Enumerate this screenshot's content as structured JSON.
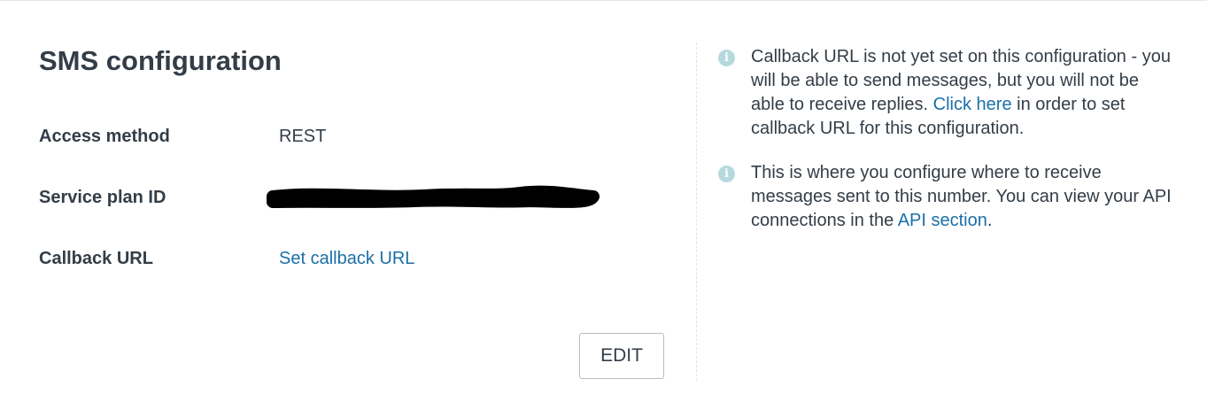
{
  "config": {
    "title": "SMS configuration",
    "rows": [
      {
        "label": "Access method",
        "value": "REST"
      },
      {
        "label": "Service plan ID",
        "value": ""
      },
      {
        "label": "Callback URL",
        "value": "Set callback URL"
      }
    ],
    "edit_label": "EDIT"
  },
  "info": [
    {
      "before": "Callback URL is not yet set on this configuration - you will be able to send messages, but you will not be able to receive replies. ",
      "link": "Click here",
      "after": " in order to set callback URL for this configuration."
    },
    {
      "before": "This is where you configure where to receive messages sent to this number. You can view your API connections in the ",
      "link": "API section",
      "after": "."
    }
  ],
  "colors": {
    "text": "#333d47",
    "link": "#1b6fa8",
    "info_icon": "#b5d9de",
    "border": "#b5bcc2"
  },
  "icons": {
    "info": "info-icon"
  }
}
